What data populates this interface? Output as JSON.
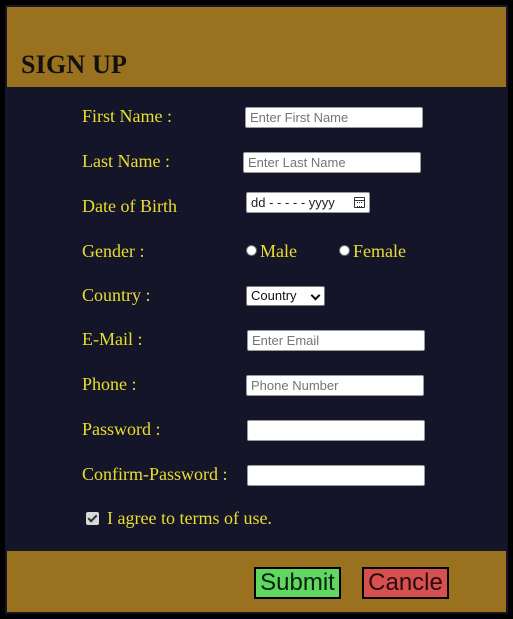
{
  "form_title": "SIGN UP",
  "fields": {
    "first_name": {
      "label": "First Name :",
      "placeholder": "Enter First Name",
      "value": ""
    },
    "last_name": {
      "label": "Last Name :",
      "placeholder": "Enter Last Name",
      "value": ""
    },
    "dob": {
      "label": "Date of Birth",
      "value": "dd - - - - - yyyy"
    },
    "gender": {
      "label": "Gender :",
      "options": [
        "Male",
        "Female"
      ]
    },
    "country": {
      "label": "Country :",
      "selected": "Country"
    },
    "email": {
      "label": "E-Mail :",
      "placeholder": "Enter Email",
      "value": ""
    },
    "phone": {
      "label": "Phone :",
      "placeholder": "Phone Number",
      "value": ""
    },
    "password": {
      "label": "Password :",
      "value": ""
    },
    "confirm_password": {
      "label": "Confirm-Password :",
      "value": ""
    }
  },
  "terms": {
    "label": "I agree to terms of use.",
    "checked": true
  },
  "buttons": {
    "submit": "Submit",
    "cancel": "Cancle"
  },
  "colors": {
    "panel_bg": "#15152a",
    "header_bg": "#9a721f",
    "label_text": "#e7de2f",
    "submit_bg": "#5ed860",
    "cancel_bg": "#d75050"
  },
  "icons": {
    "date_picker": "calendar-icon",
    "country_select": "chevron-down-icon"
  }
}
